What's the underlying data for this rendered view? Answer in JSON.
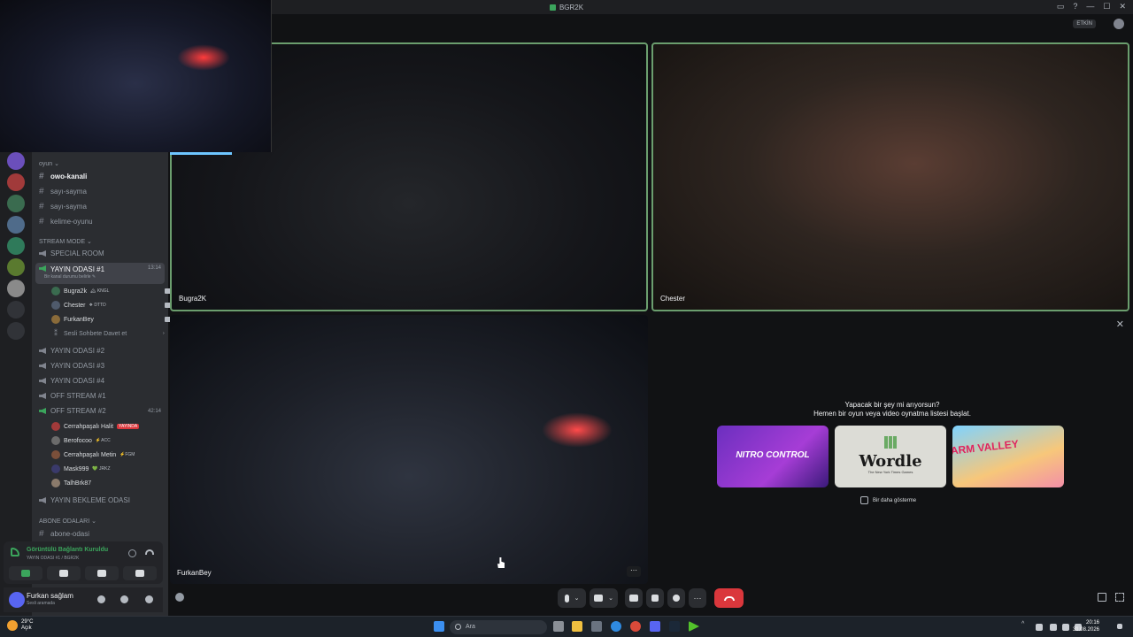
{
  "window": {
    "title": "BGR2K",
    "controls": [
      "▭",
      "?",
      "—",
      "☐",
      "✕"
    ]
  },
  "topbar": {
    "badge": "ETKİN"
  },
  "sidebar": {
    "category_oyun": "oyun ⌄",
    "text_channels": [
      {
        "label": "owo-kanali",
        "bold": true
      },
      {
        "label": "sayı-sayma",
        "bold": false
      },
      {
        "label": "sayı-sayma",
        "bold": false
      },
      {
        "label": "kelime-oyunu",
        "bold": false
      }
    ],
    "category_stream": "STREAM MODE ⌄",
    "special_room": "SPECIAL ROOM",
    "active_voice": {
      "label": "YAYIN ODASI #1",
      "count": "13:14",
      "sub": "Bir kanal durumu belirle ✎"
    },
    "active_members": [
      {
        "name": "Bugra2k",
        "tag": "🏔 KNGL"
      },
      {
        "name": "Chester",
        "tag": "❖ DTTD"
      },
      {
        "name": "FurkanBey",
        "tag": ""
      },
      {
        "name": "Sesli Sohbete Davet et",
        "tag": "›"
      }
    ],
    "voice_channels": [
      "YAYIN ODASI #2",
      "YAYIN ODASI #3",
      "YAYIN ODASI #4",
      "OFF STREAM #1"
    ],
    "off_stream_2": {
      "label": "OFF STREAM #2",
      "count": "42:14"
    },
    "off_members": [
      {
        "name": "Cerrahpaşalı Halit",
        "tag": "YAYINDA"
      },
      {
        "name": "Berofocoo",
        "tag": "⚡ACC"
      },
      {
        "name": "Cerrahpaşalı Metin",
        "tag": "⚡FGM"
      },
      {
        "name": "Mask999",
        "tag": "💚 JRKZ"
      },
      {
        "name": "TalhBrk87",
        "tag": ""
      }
    ],
    "waiting_room": "YAYIN BEKLEME ODASI",
    "category_abone": "ABONE ODALARI ⌄",
    "abone_channel": "abone-odasi"
  },
  "voice_panel": {
    "status": "Görüntülü Bağlantı Kuruldu",
    "channel": "YAYIN ODASI #1 / BGR2K"
  },
  "user_panel": {
    "name": "Furkan sağlam",
    "status": "Sesli aramada"
  },
  "tiles": {
    "tile1_name": "Bugra2K",
    "tile2_name": "Chester",
    "tile3_name": "FurkanBey",
    "more": "···"
  },
  "activity": {
    "close": "✕",
    "question": "Yapacak bir şey mi arıyorsun?",
    "prompt": "Hemen bir oyun veya video oynatma listesi başlat.",
    "cards": [
      {
        "title": "NITRO CONTROL"
      },
      {
        "title": "Wordle",
        "subtitle": "The New York Times Games"
      },
      {
        "title": "FARM VALLEY"
      }
    ],
    "checkbox": "Bir daha gösterme"
  },
  "taskbar": {
    "temp": "29°C",
    "weather": "Açık",
    "search_placeholder": "Ara",
    "time": "20:16",
    "date": "31.08.2026"
  }
}
